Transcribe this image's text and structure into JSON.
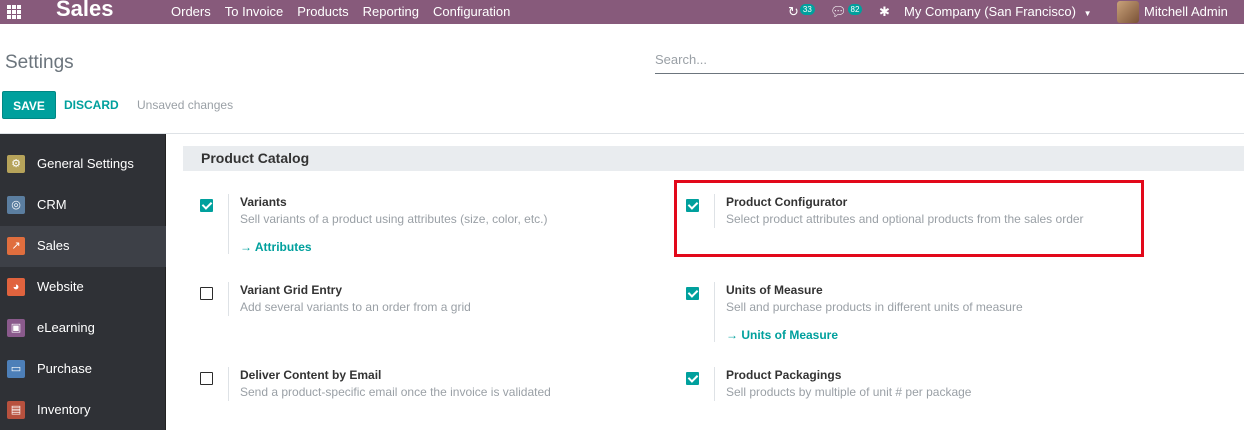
{
  "navbar": {
    "app_title": "Sales",
    "menu": [
      "Orders",
      "To Invoice",
      "Products",
      "Reporting",
      "Configuration"
    ],
    "activity_count": "33",
    "message_count": "82",
    "company": "My Company (San Francisco)",
    "user": "Mitchell Admin"
  },
  "control_panel": {
    "title": "Settings",
    "search_placeholder": "Search...",
    "save_label": "SAVE",
    "discard_label": "DISCARD",
    "status": "Unsaved changes"
  },
  "sidebar": {
    "items": [
      {
        "label": "General Settings",
        "icon": "gear-icon",
        "color": "#b6a35a"
      },
      {
        "label": "CRM",
        "icon": "handshake-icon",
        "color": "#5b7ea0"
      },
      {
        "label": "Sales",
        "icon": "chart-icon",
        "color": "#e06e3e"
      },
      {
        "label": "Website",
        "icon": "globe-icon",
        "color": "#e0633e"
      },
      {
        "label": "eLearning",
        "icon": "elearning-icon",
        "color": "#8a5a8c"
      },
      {
        "label": "Purchase",
        "icon": "card-icon",
        "color": "#4d7fb8"
      },
      {
        "label": "Inventory",
        "icon": "box-icon",
        "color": "#b7513e"
      }
    ]
  },
  "section": {
    "title": "Product Catalog",
    "settings": [
      {
        "title": "Variants",
        "desc": "Sell variants of a product using attributes (size, color, etc.)",
        "link": "Attributes",
        "checked": true
      },
      {
        "title": "Product Configurator",
        "desc": "Select product attributes and optional products from the sales order",
        "checked": true
      },
      {
        "title": "Variant Grid Entry",
        "desc": "Add several variants to an order from a grid",
        "checked": false
      },
      {
        "title": "Units of Measure",
        "desc": "Sell and purchase products in different units of measure",
        "link": "Units of Measure",
        "checked": true
      },
      {
        "title": "Deliver Content by Email",
        "desc": "Send a product-specific email once the invoice is validated",
        "checked": false
      },
      {
        "title": "Product Packagings",
        "desc": "Sell products by multiple of unit # per package",
        "checked": true
      }
    ]
  },
  "colors": {
    "brand": "#875a7b",
    "accent": "#00a09d",
    "highlight": "#e2081a"
  }
}
